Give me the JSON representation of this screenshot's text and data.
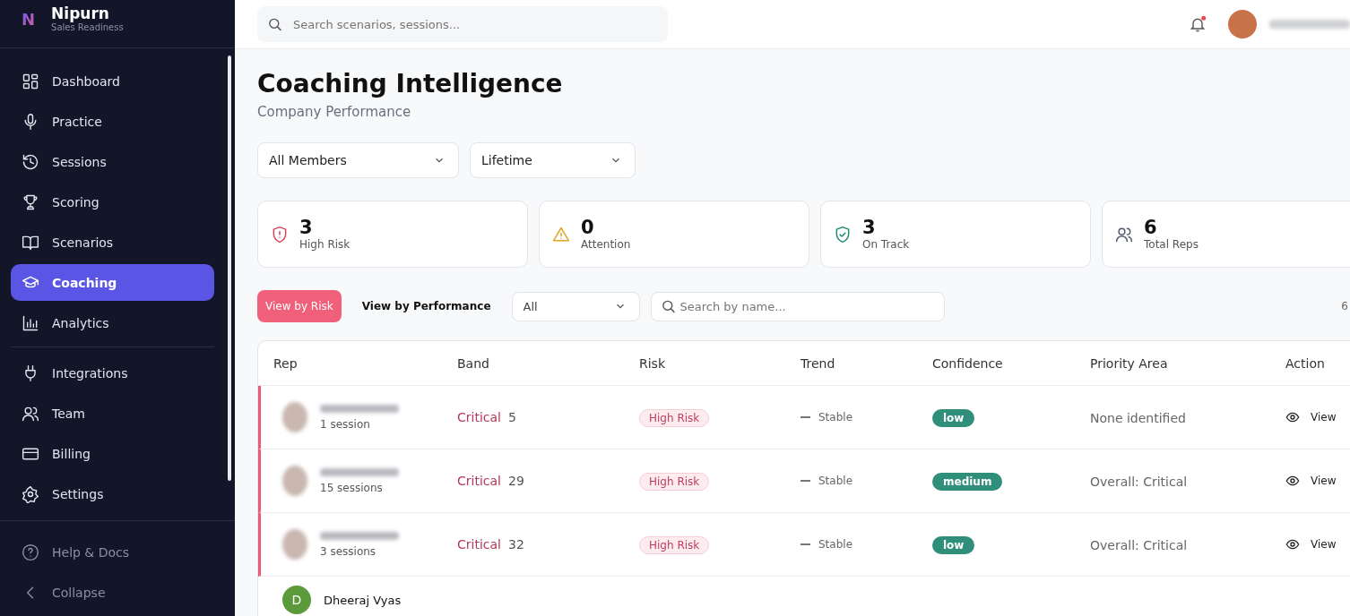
{
  "brand": {
    "name": "Nipurn",
    "tagline": "Sales Readiness",
    "logo": "N"
  },
  "nav_groups": [
    [
      {
        "label": "Dashboard",
        "selected": false
      },
      {
        "label": "Practice",
        "selected": false
      },
      {
        "label": "Sessions",
        "selected": false
      },
      {
        "label": "Scoring",
        "selected": false
      },
      {
        "label": "Scenarios",
        "selected": false
      },
      {
        "label": "Coaching",
        "selected": true
      },
      {
        "label": "Analytics",
        "selected": false
      }
    ],
    [
      {
        "label": "Integrations",
        "selected": false
      },
      {
        "label": "Team",
        "selected": false
      },
      {
        "label": "Billing",
        "selected": false
      },
      {
        "label": "Settings",
        "selected": false
      }
    ]
  ],
  "sidebar_footer": [
    "Help & Docs",
    "Collapse"
  ],
  "header": {
    "search_placeholder": "Search scenarios, sessions...",
    "has_notification": true
  },
  "page": {
    "title": "Coaching Intelligence",
    "subtitle": "Company Performance"
  },
  "filters": [
    "All Members",
    "Lifetime"
  ],
  "stats": [
    {
      "value": "3",
      "label": "High Risk",
      "kind": "risk"
    },
    {
      "value": "0",
      "label": "Attention",
      "kind": "warning"
    },
    {
      "value": "3",
      "label": "On Track",
      "kind": "ok"
    },
    {
      "value": "6",
      "label": "Total Reps",
      "kind": "people"
    }
  ],
  "view_tabs": [
    {
      "label": "View by Risk",
      "selected": true
    },
    {
      "label": "View by Performance",
      "selected": false
    }
  ],
  "status_filter": "All",
  "name_search_placeholder": "Search by name...",
  "count": "6",
  "table": {
    "columns": [
      "Rep",
      "Band",
      "Risk",
      "Trend",
      "Confidence",
      "Priority Area",
      "Action"
    ],
    "rows": [
      {
        "sessions": "1 session",
        "band": "Critical",
        "score": "5",
        "risk": "High Risk",
        "flagged": true,
        "trend": "Stable",
        "confidence": "low",
        "priority": "None identified",
        "action": "View"
      },
      {
        "sessions": "15 sessions",
        "band": "Critical",
        "score": "29",
        "risk": "High Risk",
        "flagged": true,
        "trend": "Stable",
        "confidence": "medium",
        "priority": "Overall: Critical",
        "action": "View"
      },
      {
        "sessions": "3 sessions",
        "band": "Critical",
        "score": "32",
        "risk": "High Risk",
        "flagged": true,
        "trend": "Stable",
        "confidence": "low",
        "priority": "Overall: Critical",
        "action": "View"
      },
      {
        "name": "Dheeraj Vyas",
        "initial": "D",
        "flagged": false
      }
    ]
  }
}
